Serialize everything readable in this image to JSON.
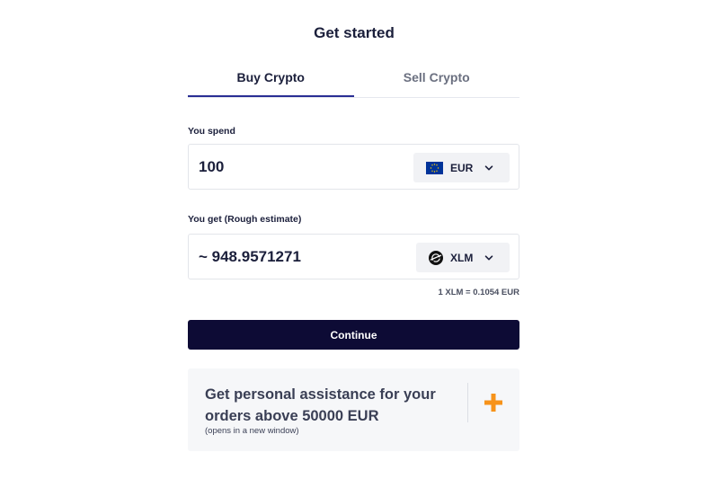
{
  "page": {
    "title": "Get started"
  },
  "tabs": [
    {
      "label": "Buy Crypto",
      "active": true
    },
    {
      "label": "Sell Crypto",
      "active": false
    }
  ],
  "spend": {
    "label": "You spend",
    "value": "100",
    "currency": {
      "code": "EUR",
      "icon": "eu-flag-icon"
    }
  },
  "get": {
    "label": "You get (Rough estimate)",
    "value": "~ 948.9571271",
    "currency": {
      "code": "XLM",
      "icon": "stellar-logo-icon"
    }
  },
  "rate": "1 XLM = 0.1054 EUR",
  "continue_label": "Continue",
  "assistance": {
    "heading": "Get personal assistance for your orders above 50000 EUR",
    "sub": "(opens in a new window)",
    "icon": "plus-icon"
  },
  "colors": {
    "primary_dark": "#0d0b35",
    "tab_underline": "#2a2f94",
    "accent_orange": "#f7931a",
    "eu_blue": "#003399",
    "eu_star": "#ffcc00"
  }
}
